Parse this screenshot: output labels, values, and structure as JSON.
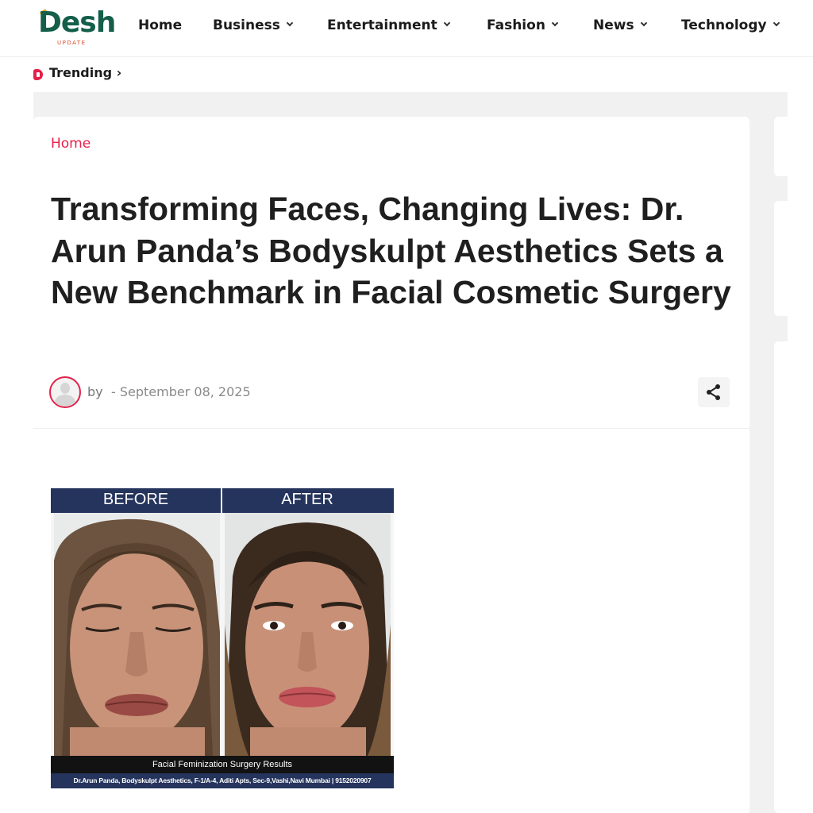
{
  "site": {
    "logo_text": "Desh",
    "logo_sub": "UPDATE"
  },
  "nav": {
    "items": [
      {
        "label": "Home",
        "has_dropdown": false
      },
      {
        "label": "Business",
        "has_dropdown": true
      },
      {
        "label": "Entertainment",
        "has_dropdown": true
      },
      {
        "label": "Fashion",
        "has_dropdown": true
      },
      {
        "label": "News",
        "has_dropdown": true
      },
      {
        "label": "Technology",
        "has_dropdown": true
      }
    ]
  },
  "trending": {
    "label": "Trending ›"
  },
  "breadcrumb": {
    "home": "Home"
  },
  "article": {
    "title": "Transforming Faces, Changing Lives: Dr. Arun Panda’s Bodyskulpt Aesthetics Sets a New Benchmark in Facial Cosmetic Surgery",
    "by": "by",
    "date": "- September 08, 2025"
  },
  "image": {
    "before_label": "BEFORE",
    "after_label": "AFTER",
    "caption": "Facial Feminization Surgery Results",
    "contact": "Dr.Arun Panda, Bodyskulpt Aesthetics, F-1/A-4, Aditi Apts, Sec-9,Vashi,Navi Mumbai | 9152020907"
  },
  "icons": {
    "trending": "flame-icon",
    "share": "share-icon",
    "avatar": "user-avatar-icon",
    "dropdown": "chevron-down-icon"
  },
  "colors": {
    "accent": "#e5204a",
    "brand_green": "#145e4a",
    "image_banner": "#25345d",
    "page_gray": "#f1f1f1"
  }
}
